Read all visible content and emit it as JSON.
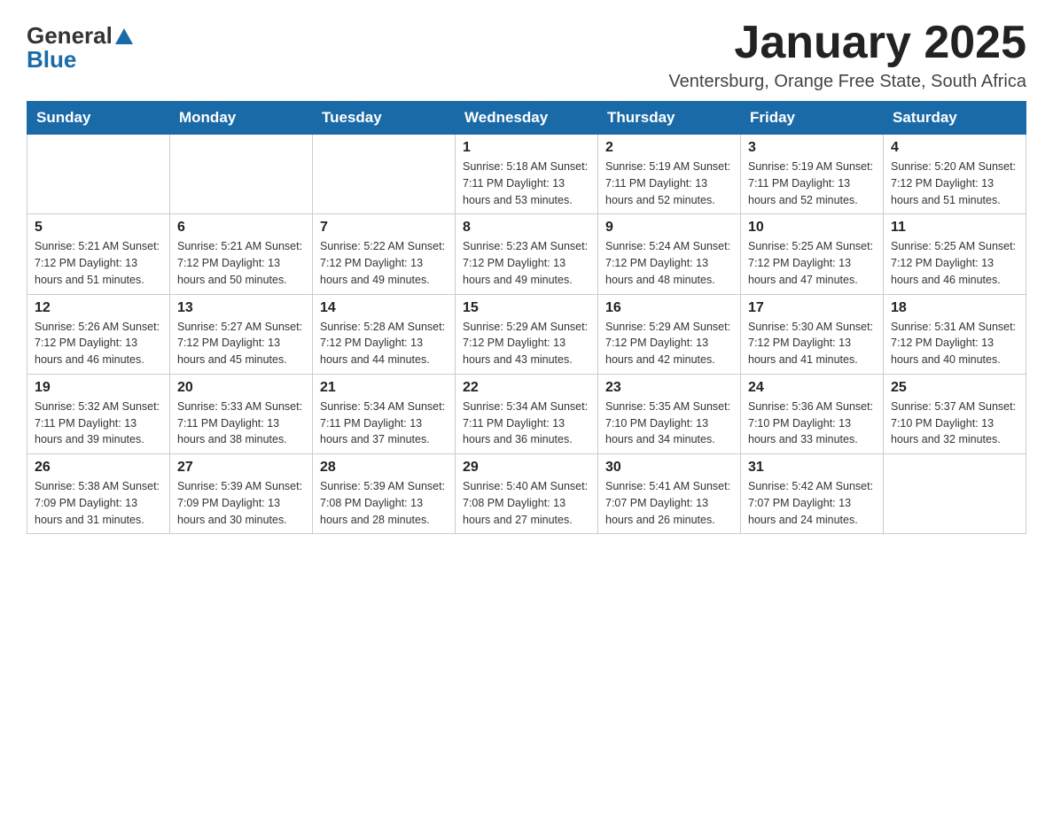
{
  "header": {
    "logo_general": "General",
    "logo_blue": "Blue",
    "month_title": "January 2025",
    "location": "Ventersburg, Orange Free State, South Africa"
  },
  "days_of_week": [
    "Sunday",
    "Monday",
    "Tuesday",
    "Wednesday",
    "Thursday",
    "Friday",
    "Saturday"
  ],
  "weeks": [
    [
      {
        "day": "",
        "info": ""
      },
      {
        "day": "",
        "info": ""
      },
      {
        "day": "",
        "info": ""
      },
      {
        "day": "1",
        "info": "Sunrise: 5:18 AM\nSunset: 7:11 PM\nDaylight: 13 hours\nand 53 minutes."
      },
      {
        "day": "2",
        "info": "Sunrise: 5:19 AM\nSunset: 7:11 PM\nDaylight: 13 hours\nand 52 minutes."
      },
      {
        "day": "3",
        "info": "Sunrise: 5:19 AM\nSunset: 7:11 PM\nDaylight: 13 hours\nand 52 minutes."
      },
      {
        "day": "4",
        "info": "Sunrise: 5:20 AM\nSunset: 7:12 PM\nDaylight: 13 hours\nand 51 minutes."
      }
    ],
    [
      {
        "day": "5",
        "info": "Sunrise: 5:21 AM\nSunset: 7:12 PM\nDaylight: 13 hours\nand 51 minutes."
      },
      {
        "day": "6",
        "info": "Sunrise: 5:21 AM\nSunset: 7:12 PM\nDaylight: 13 hours\nand 50 minutes."
      },
      {
        "day": "7",
        "info": "Sunrise: 5:22 AM\nSunset: 7:12 PM\nDaylight: 13 hours\nand 49 minutes."
      },
      {
        "day": "8",
        "info": "Sunrise: 5:23 AM\nSunset: 7:12 PM\nDaylight: 13 hours\nand 49 minutes."
      },
      {
        "day": "9",
        "info": "Sunrise: 5:24 AM\nSunset: 7:12 PM\nDaylight: 13 hours\nand 48 minutes."
      },
      {
        "day": "10",
        "info": "Sunrise: 5:25 AM\nSunset: 7:12 PM\nDaylight: 13 hours\nand 47 minutes."
      },
      {
        "day": "11",
        "info": "Sunrise: 5:25 AM\nSunset: 7:12 PM\nDaylight: 13 hours\nand 46 minutes."
      }
    ],
    [
      {
        "day": "12",
        "info": "Sunrise: 5:26 AM\nSunset: 7:12 PM\nDaylight: 13 hours\nand 46 minutes."
      },
      {
        "day": "13",
        "info": "Sunrise: 5:27 AM\nSunset: 7:12 PM\nDaylight: 13 hours\nand 45 minutes."
      },
      {
        "day": "14",
        "info": "Sunrise: 5:28 AM\nSunset: 7:12 PM\nDaylight: 13 hours\nand 44 minutes."
      },
      {
        "day": "15",
        "info": "Sunrise: 5:29 AM\nSunset: 7:12 PM\nDaylight: 13 hours\nand 43 minutes."
      },
      {
        "day": "16",
        "info": "Sunrise: 5:29 AM\nSunset: 7:12 PM\nDaylight: 13 hours\nand 42 minutes."
      },
      {
        "day": "17",
        "info": "Sunrise: 5:30 AM\nSunset: 7:12 PM\nDaylight: 13 hours\nand 41 minutes."
      },
      {
        "day": "18",
        "info": "Sunrise: 5:31 AM\nSunset: 7:12 PM\nDaylight: 13 hours\nand 40 minutes."
      }
    ],
    [
      {
        "day": "19",
        "info": "Sunrise: 5:32 AM\nSunset: 7:11 PM\nDaylight: 13 hours\nand 39 minutes."
      },
      {
        "day": "20",
        "info": "Sunrise: 5:33 AM\nSunset: 7:11 PM\nDaylight: 13 hours\nand 38 minutes."
      },
      {
        "day": "21",
        "info": "Sunrise: 5:34 AM\nSunset: 7:11 PM\nDaylight: 13 hours\nand 37 minutes."
      },
      {
        "day": "22",
        "info": "Sunrise: 5:34 AM\nSunset: 7:11 PM\nDaylight: 13 hours\nand 36 minutes."
      },
      {
        "day": "23",
        "info": "Sunrise: 5:35 AM\nSunset: 7:10 PM\nDaylight: 13 hours\nand 34 minutes."
      },
      {
        "day": "24",
        "info": "Sunrise: 5:36 AM\nSunset: 7:10 PM\nDaylight: 13 hours\nand 33 minutes."
      },
      {
        "day": "25",
        "info": "Sunrise: 5:37 AM\nSunset: 7:10 PM\nDaylight: 13 hours\nand 32 minutes."
      }
    ],
    [
      {
        "day": "26",
        "info": "Sunrise: 5:38 AM\nSunset: 7:09 PM\nDaylight: 13 hours\nand 31 minutes."
      },
      {
        "day": "27",
        "info": "Sunrise: 5:39 AM\nSunset: 7:09 PM\nDaylight: 13 hours\nand 30 minutes."
      },
      {
        "day": "28",
        "info": "Sunrise: 5:39 AM\nSunset: 7:08 PM\nDaylight: 13 hours\nand 28 minutes."
      },
      {
        "day": "29",
        "info": "Sunrise: 5:40 AM\nSunset: 7:08 PM\nDaylight: 13 hours\nand 27 minutes."
      },
      {
        "day": "30",
        "info": "Sunrise: 5:41 AM\nSunset: 7:07 PM\nDaylight: 13 hours\nand 26 minutes."
      },
      {
        "day": "31",
        "info": "Sunrise: 5:42 AM\nSunset: 7:07 PM\nDaylight: 13 hours\nand 24 minutes."
      },
      {
        "day": "",
        "info": ""
      }
    ]
  ]
}
